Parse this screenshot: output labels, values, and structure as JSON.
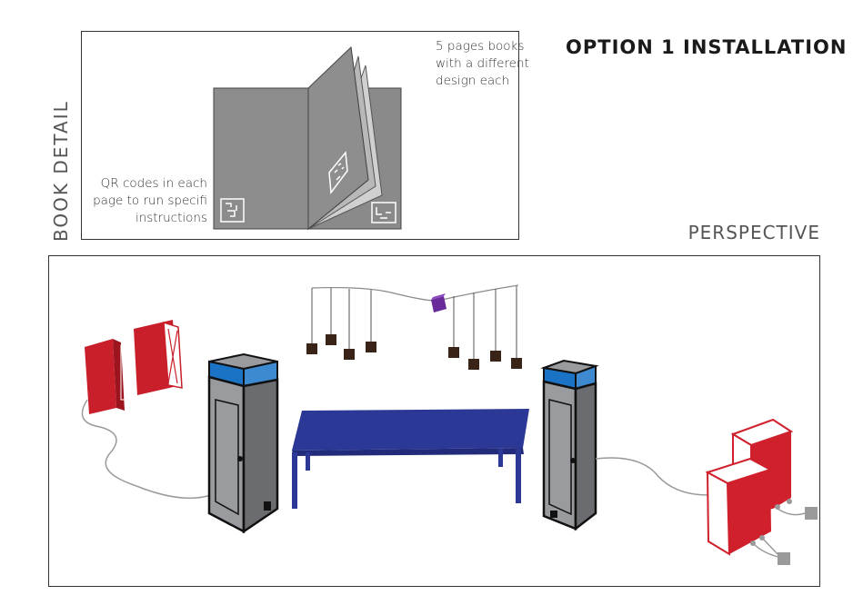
{
  "title": "OPTION 1 INSTALLATION",
  "book_detail": {
    "label": "BOOK DETAIL",
    "note_pages_line1": "5 pages books",
    "note_pages_line2": "with a different",
    "note_pages_line3": "design each",
    "note_qr_line1": "QR codes in each",
    "note_qr_line2": "page to run specifi",
    "note_qr_line3": "instructions"
  },
  "perspective": {
    "label": "PERSPECTIVE"
  },
  "colors": {
    "book_gray": "#8a8a8a",
    "booth_gray": "#9a9b9e",
    "screen_blue": "#1a73c4",
    "table_blue": "#2c3896",
    "speaker_red": "#d0202c",
    "cube_brown": "#3a2418",
    "cube_purple": "#6a2b9a",
    "cable_gray": "#9a9a9a"
  }
}
